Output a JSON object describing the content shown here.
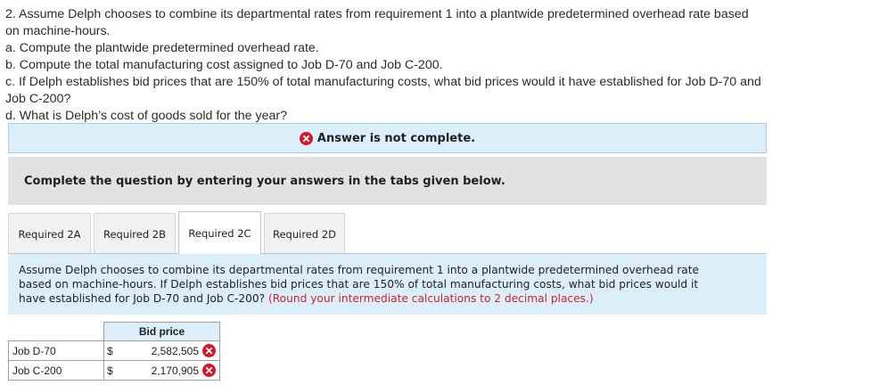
{
  "question": {
    "line1": "2. Assume Delph chooses to combine its departmental rates from requirement 1 into a plantwide predetermined overhead rate based",
    "line2": "on machine-hours.",
    "line3": "a. Compute the plantwide predetermined overhead rate.",
    "line4": "b. Compute the total manufacturing cost assigned to Job D-70 and Job C-200.",
    "line5": "c. If Delph establishes bid prices that are 150% of total manufacturing costs, what bid prices would it have established for Job D-70 and",
    "line6": "Job C-200?",
    "line7": "d. What is Delph’s cost of goods sold for the year?"
  },
  "status": {
    "text": "Answer is not complete.",
    "icon": "x-circle-icon",
    "color": "#d6162b"
  },
  "instruction": "Complete the question by entering your answers in the tabs given below.",
  "tabs": [
    {
      "label": "Required 2A",
      "active": false
    },
    {
      "label": "Required 2B",
      "active": false
    },
    {
      "label": "Required 2C",
      "active": true
    },
    {
      "label": "Required 2D",
      "active": false
    }
  ],
  "prompt": {
    "line1": "Assume Delph chooses to combine its departmental rates from requirement 1 into a plantwide predetermined overhead rate",
    "line2": "based on machine-hours. If Delph establishes bid prices that are 150% of total manufacturing costs, what bid prices would it",
    "line3": "have established for Job D-70 and Job C-200? ",
    "note": "(Round your intermediate calculations to 2 decimal places.)"
  },
  "table": {
    "header": "Bid price",
    "rows": [
      {
        "label": "Job D-70",
        "currency": "$",
        "value": "2,582,505",
        "correct": false
      },
      {
        "label": "Job C-200",
        "currency": "$",
        "value": "2,170,905",
        "correct": false
      }
    ]
  },
  "colors": {
    "accent_blue": "#ddeefb",
    "error_red": "#d6162b",
    "note_red": "#c7262c"
  }
}
